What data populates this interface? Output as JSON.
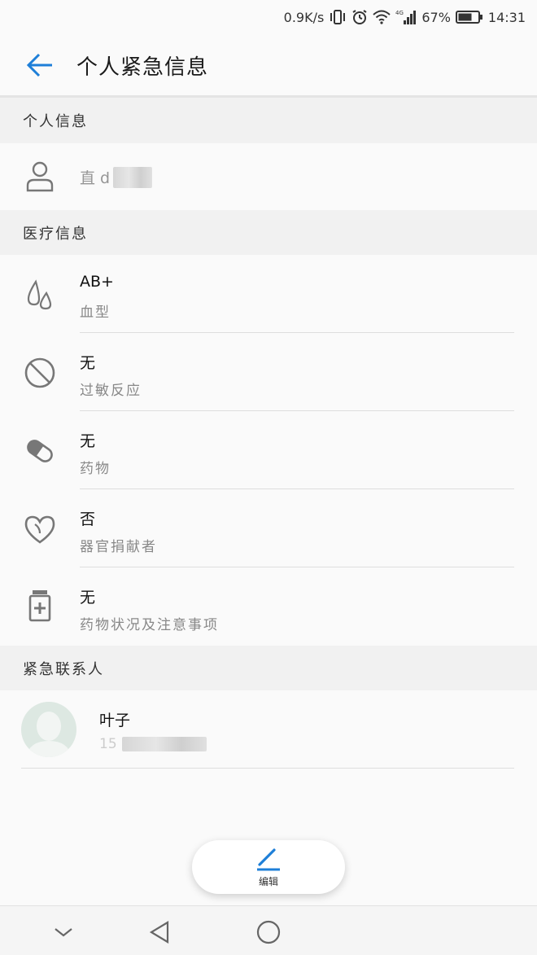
{
  "status_bar": {
    "net_speed": "0.9K/s",
    "network_type": "4G",
    "battery_percent": "67%",
    "time": "14:31",
    "icons": [
      "vibrate-icon",
      "alarm-icon",
      "wifi-icon",
      "signal-icon",
      "battery-icon"
    ]
  },
  "app_bar": {
    "title": "个人紧急信息",
    "back_icon": "arrow-left-icon"
  },
  "personal_section": {
    "header": "个人信息",
    "name_value_visible": "直 d",
    "icon": "person-icon"
  },
  "medical_section": {
    "header": "医疗信息",
    "items": [
      {
        "value": "AB+",
        "label": "血型",
        "icon": "blood-drops-icon"
      },
      {
        "value": "无",
        "label": "过敏反应",
        "icon": "prohibited-icon"
      },
      {
        "value": "无",
        "label": "药物",
        "icon": "pill-icon"
      },
      {
        "value": "否",
        "label": "器官捐献者",
        "icon": "heart-icon"
      },
      {
        "value": "无",
        "label": "药物状况及注意事项",
        "icon": "medicine-bottle-icon"
      }
    ]
  },
  "contacts_section": {
    "header": "紧急联系人",
    "contacts": [
      {
        "name": "叶子",
        "phone_visible": "15",
        "icon": "avatar"
      }
    ]
  },
  "fab": {
    "label": "编辑",
    "icon": "pencil-icon"
  },
  "nav_bar": {
    "icons": [
      "collapse-icon",
      "back-triangle-icon",
      "home-circle-icon"
    ]
  },
  "colors": {
    "accent": "#1e7fd8",
    "background": "#fafafa",
    "section_header_bg": "#f1f1f1",
    "secondary_text": "#888888"
  }
}
